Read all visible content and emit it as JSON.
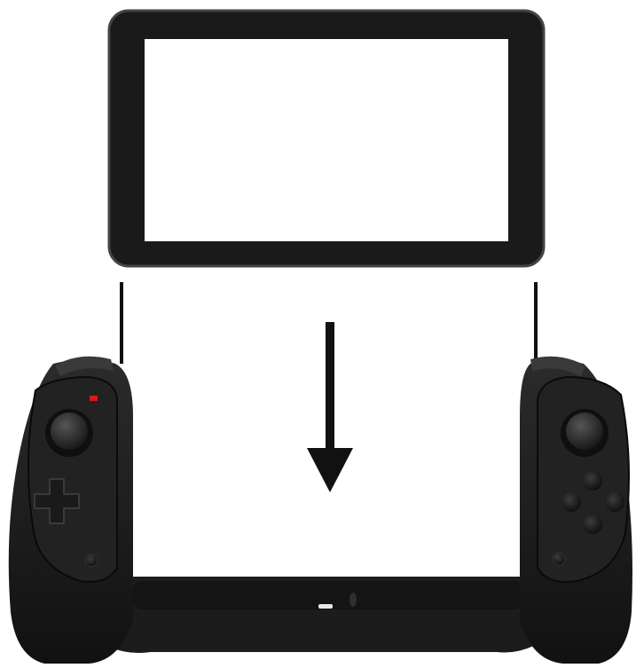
{
  "figure": {
    "tablet": {
      "bezel_color": "#1a1a1a",
      "screen_color": "#ffffff"
    },
    "guide_lines": {
      "color": "#111111"
    },
    "arrow": {
      "direction": "down",
      "color": "#111111"
    },
    "controller": {
      "body_color": "#1c1c1c",
      "highlight_color": "#3a3a3a",
      "indicator_light_color": "#e0161b",
      "left_grip": {
        "controls": [
          "analog-stick",
          "d-pad",
          "small-button"
        ]
      },
      "right_grip": {
        "controls": [
          "analog-stick",
          "face-buttons",
          "small-button"
        ]
      }
    }
  }
}
